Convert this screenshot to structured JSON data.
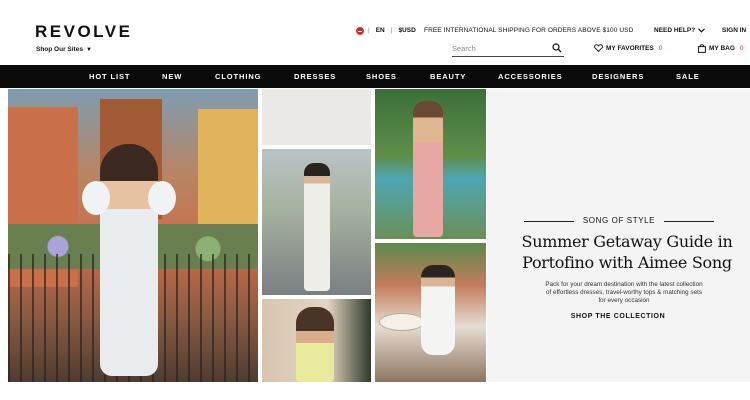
{
  "header": {
    "logo": "REVOLVE",
    "shop_sites": "Shop Our Sites",
    "language": "EN",
    "currency": "$USD",
    "shipping_notice": "FREE INTERNATIONAL SHIPPING FOR ORDERS ABOVE $100 USD",
    "need_help": "NEED HELP?",
    "sign_in": "SIGN IN",
    "search_placeholder": "Search",
    "favorites_label": "MY FAVORITES",
    "favorites_count": "0",
    "bag_label": "MY BAG",
    "bag_count": "0",
    "accent_color": "#d0312d"
  },
  "nav": {
    "items": [
      "HOT LIST",
      "NEW",
      "CLOTHING",
      "DRESSES",
      "SHOES",
      "BEAUTY",
      "ACCESSORIES",
      "DESIGNERS",
      "SALE"
    ]
  },
  "promo": {
    "brand": "SONG OF STYLE",
    "headline_line1": "Summer Getaway Guide in",
    "headline_line2": "Portofino with Aimee Song",
    "description_line1": "Pack for your dream destination with the latest collection",
    "description_line2": "of effortless dresses, travel-worthy tops & matching sets",
    "description_line3": "for every occasion",
    "cta": "SHOP THE COLLECTION"
  }
}
